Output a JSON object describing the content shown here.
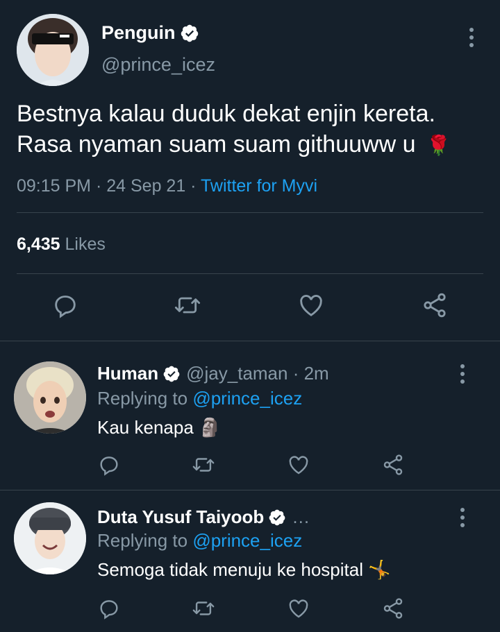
{
  "main_tweet": {
    "author_name": "Penguin",
    "author_handle": "@prince_icez",
    "text_line1": "Bestnya kalau duduk dekat enjin kereta.",
    "text_line2": "Rasa nyaman suam suam githuuww u",
    "text_emoji": "🌹",
    "time": "09:15 PM",
    "date": "24 Sep 21",
    "source": "Twitter for Myvi",
    "likes_count": "6,435",
    "likes_label": "Likes",
    "actions": [
      "reply-icon",
      "retweet-icon",
      "like-icon",
      "share-icon"
    ]
  },
  "replies": [
    {
      "author_name": "Human",
      "author_handle": "@jay_taman",
      "time": "2m",
      "replying_label": "Replying to",
      "replying_to": "@prince_icez",
      "text": "Kau kenapa",
      "emoji": "🗿"
    },
    {
      "author_name": "Duta Yusuf Taiyoob",
      "author_handle": "…",
      "replying_label": "Replying to",
      "replying_to": "@prince_icez",
      "text": "Semoga tidak menuju ke hospital",
      "emoji": "🤸"
    }
  ],
  "colors": {
    "background": "#15202b",
    "divider": "#38444d",
    "secondary_text": "#8899a6",
    "accent": "#1da1f2",
    "verified_badge": "#ffffff"
  }
}
